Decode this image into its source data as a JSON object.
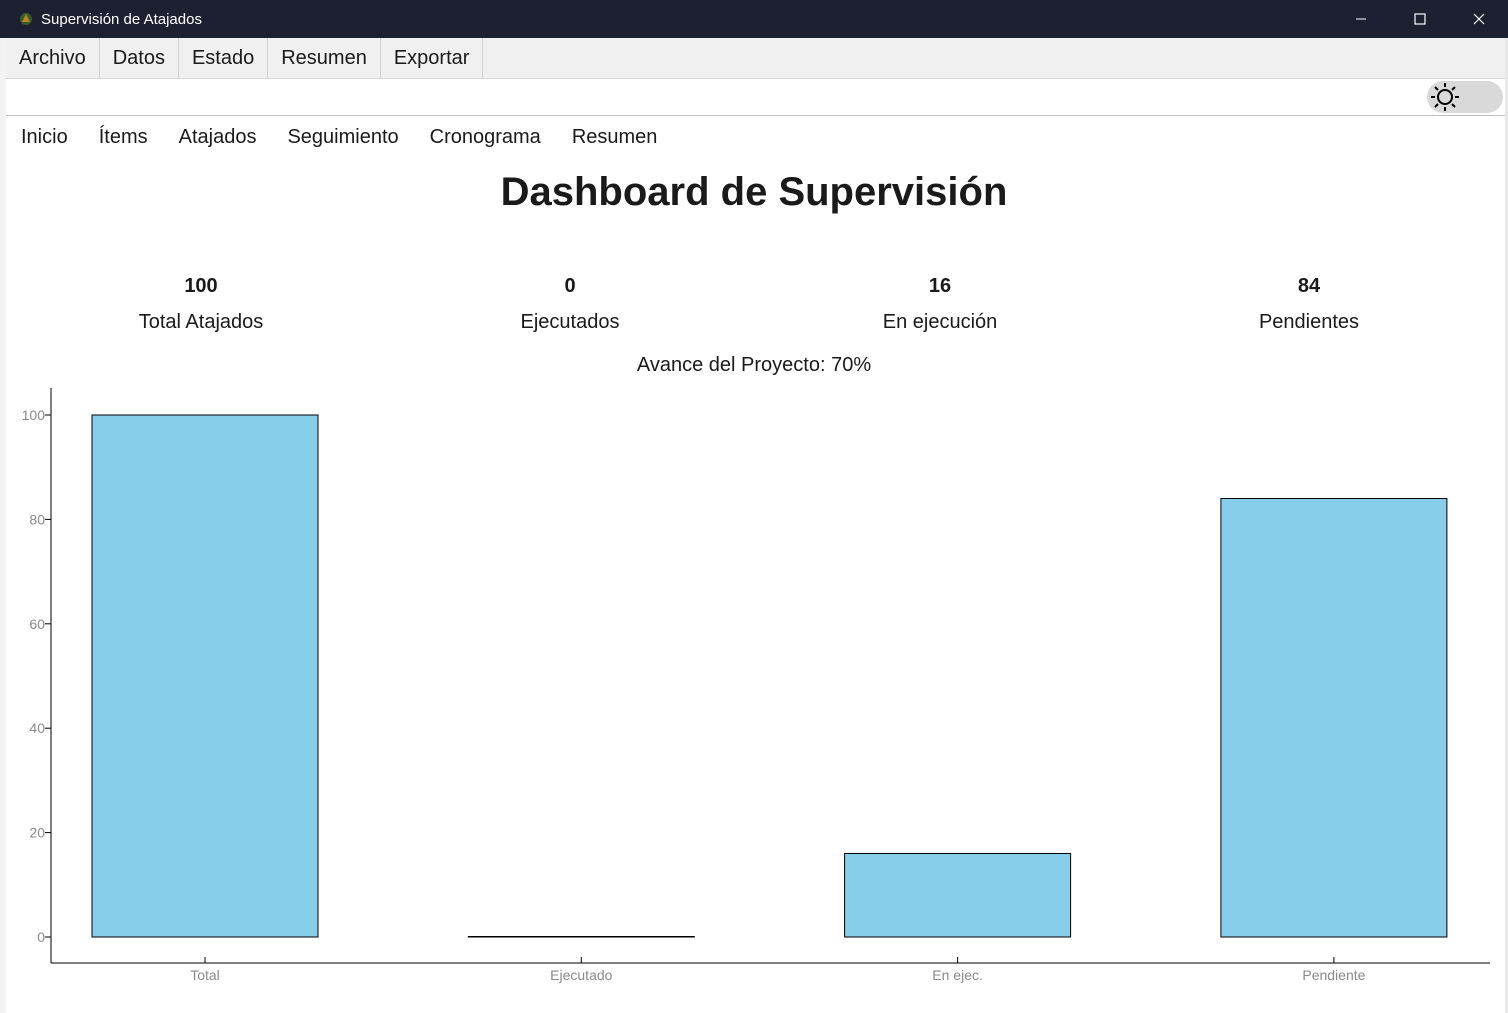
{
  "window": {
    "title": "Supervisión de Atajados",
    "icons": [
      "app-icon",
      "minimize-icon",
      "maximize-icon",
      "close-icon"
    ]
  },
  "menu": [
    "Archivo",
    "Datos",
    "Estado",
    "Resumen",
    "Exportar"
  ],
  "toolbar": {
    "theme_toggle_icon": "sun-icon"
  },
  "tabs": [
    "Inicio",
    "Ítems",
    "Atajados",
    "Seguimiento",
    "Cronograma",
    "Resumen"
  ],
  "page_title": "Dashboard de Supervisión",
  "stats": [
    {
      "value": "100",
      "label": "Total Atajados"
    },
    {
      "value": "0",
      "label": "Ejecutados"
    },
    {
      "value": "16",
      "label": "En ejecución"
    },
    {
      "value": "84",
      "label": "Pendientes"
    }
  ],
  "progress_text": "Avance del Proyecto: 70%",
  "chart_data": {
    "type": "bar",
    "categories": [
      "Total",
      "Ejecutado",
      "En ejec.",
      "Pendiente"
    ],
    "values": [
      100,
      0,
      16,
      84
    ],
    "yticks": [
      0,
      20,
      40,
      60,
      80,
      100
    ],
    "ylim": [
      0,
      105
    ],
    "grid": false,
    "bar_color": "#87ceeb",
    "edge_color": "#000000"
  }
}
